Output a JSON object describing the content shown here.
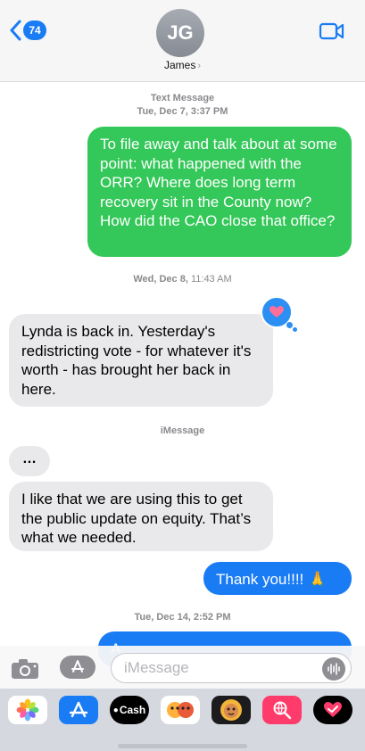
{
  "header": {
    "unread_count": "74",
    "avatar_initials": "JG",
    "contact_name": "James",
    "chevron": "›"
  },
  "conversation": {
    "section1": {
      "service": "Text Message",
      "timestamp": "Tue, Dec 7, 3:37 PM"
    },
    "msg1": "To file away and talk about at some point: what happened with the ORR? Where does long term recovery sit in the County now? How did the CAO close that office?",
    "section2": {
      "day": "Wed, Dec 8,",
      "time": " 11:43 AM"
    },
    "msg2": "Lynda is back in.  Yesterday's redistricting vote - for whatever it's worth - has brought her back in here.",
    "reaction": "heart",
    "section3": {
      "service": "iMessage"
    },
    "typing": "…",
    "msg3": "I like that we are using this to get the public update on equity. That’s what we needed.",
    "msg4": "Thank you!!!! 🙏",
    "section4": {
      "timestamp": "Tue, Dec 14, 2:52 PM"
    },
    "msg5_partial": "A…"
  },
  "composer": {
    "placeholder": "iMessage",
    "value": ""
  },
  "drawer": {
    "apps": [
      "photos",
      "app-store",
      "Cash",
      "memoji-stickers",
      "animoji",
      "image-search",
      "digital-touch"
    ],
    "cash_label": "Cash"
  },
  "colors": {
    "sms_green": "#34c759",
    "imessage_blue": "#1a7cf5",
    "received_gray": "#e9e9eb"
  }
}
